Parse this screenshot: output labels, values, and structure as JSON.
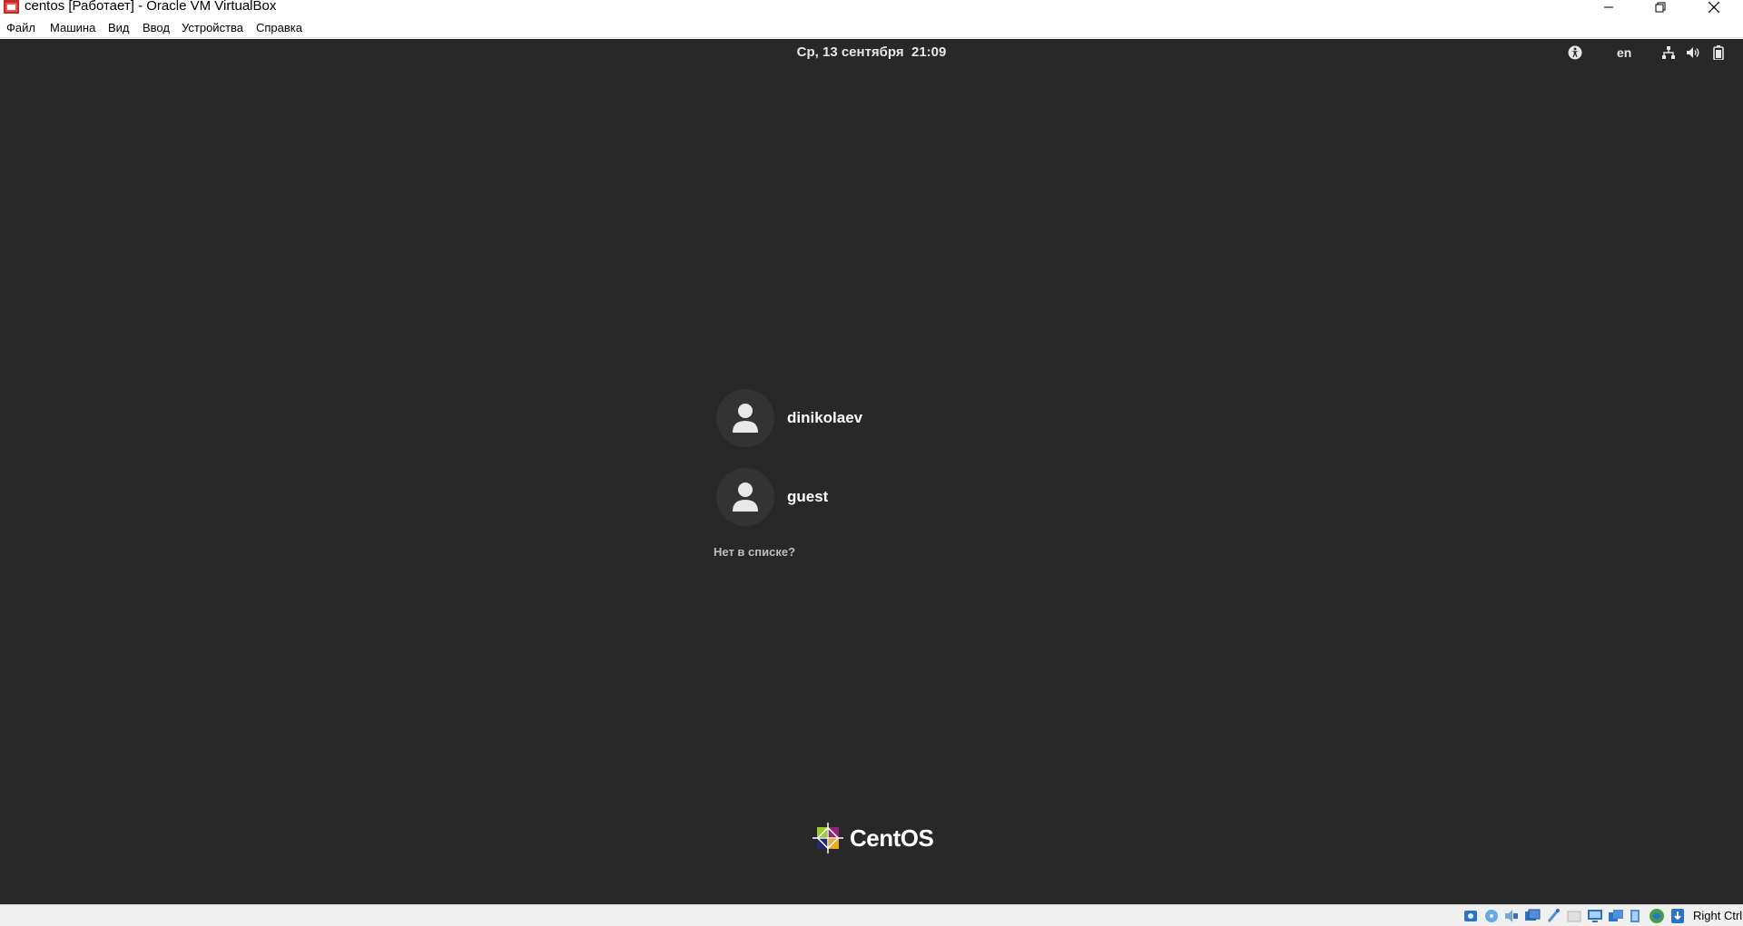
{
  "window": {
    "title": "centos [Работает] - Oracle VM VirtualBox",
    "icon": "virtualbox-app-icon"
  },
  "menubar": {
    "items": [
      {
        "label": "Файл"
      },
      {
        "label": "Машина"
      },
      {
        "label": "Вид"
      },
      {
        "label": "Ввод"
      },
      {
        "label": "Устройства"
      },
      {
        "label": "Справка"
      }
    ]
  },
  "guest": {
    "topbar": {
      "clock": "Ср, 13 сентября  21:09",
      "language": "en",
      "icons": [
        "accessibility-icon",
        "network-icon",
        "volume-icon",
        "battery-icon"
      ]
    },
    "login": {
      "users": [
        {
          "name": "dinikolaev"
        },
        {
          "name": "guest"
        }
      ],
      "not_listed": "Нет в списке?"
    },
    "brand": {
      "text": "CentOS"
    }
  },
  "statusbar": {
    "host_key": "Right Ctrl",
    "icons": [
      "hard-disk-icon",
      "optical-drive-icon",
      "audio-icon",
      "network-adapter-icon",
      "usb-icon",
      "shared-folders-icon",
      "display-icon",
      "recording-icon",
      "cpu-icon",
      "guest-additions-icon",
      "mouse-integration-icon",
      "keyboard-icon"
    ]
  },
  "colors": {
    "screen_bg": "#282828",
    "avatar_bg": "#333333",
    "statusbar_bg": "#f0f0f0"
  }
}
